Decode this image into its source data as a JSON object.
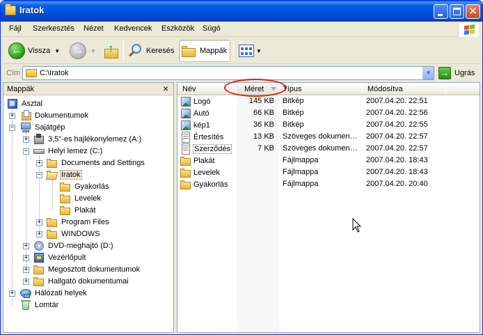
{
  "window": {
    "title": "Iratok"
  },
  "menu": [
    "Fájl",
    "Szerkesztés",
    "Nézet",
    "Kedvencek",
    "Eszközök",
    "Súgó"
  ],
  "toolbar": {
    "back_label": "Vissza",
    "search_label": "Keresés",
    "folders_label": "Mappák"
  },
  "address": {
    "label": "Cím",
    "value": "C:\\Iratok",
    "go_label": "Ugrás"
  },
  "folder_pane": {
    "title": "Mappák",
    "close": "×",
    "tree": [
      {
        "label": "Asztal",
        "icon": "desktop-icon",
        "expander": ""
      },
      {
        "label": "Dokumentumok",
        "icon": "my-documents-icon",
        "expander": "+"
      },
      {
        "label": "Sajátgép",
        "icon": "my-computer-icon",
        "expander": "−"
      },
      {
        "label": "3,5\"-es hajlékonylemez (A:)",
        "icon": "floppy-drive-icon",
        "expander": "+"
      },
      {
        "label": "Helyi lemez (C:)",
        "icon": "hard-drive-icon",
        "expander": "−"
      },
      {
        "label": "Documents and Settings",
        "icon": "folder-icon",
        "expander": "+"
      },
      {
        "label": "Iratok",
        "icon": "open-folder-icon",
        "expander": "−",
        "selected": true
      },
      {
        "label": "Gyakorlás",
        "icon": "folder-icon",
        "expander": ""
      },
      {
        "label": "Levelek",
        "icon": "folder-icon",
        "expander": ""
      },
      {
        "label": "Plakát",
        "icon": "folder-icon",
        "expander": ""
      },
      {
        "label": "Program Files",
        "icon": "folder-icon",
        "expander": "+"
      },
      {
        "label": "WINDOWS",
        "icon": "folder-icon",
        "expander": "+"
      },
      {
        "label": "DVD-meghajtó (D:)",
        "icon": "dvd-drive-icon",
        "expander": "+"
      },
      {
        "label": "Vezérlőpult",
        "icon": "control-panel-icon",
        "expander": "+"
      },
      {
        "label": "Megosztott dokumentumok",
        "icon": "folder-icon",
        "expander": "+"
      },
      {
        "label": "Hallgató dokumentumai",
        "icon": "folder-icon",
        "expander": "+"
      },
      {
        "label": "Hálózati helyek",
        "icon": "network-places-icon",
        "expander": "+"
      },
      {
        "label": "Lomtár",
        "icon": "recycle-bin-icon",
        "expander": ""
      }
    ]
  },
  "file_list": {
    "columns": [
      "Név",
      "Méret",
      "Típus",
      "Módosítva"
    ],
    "rows": [
      {
        "name": "Logó",
        "size": "145 KB",
        "type": "Bitkép",
        "modified": "2007.04.20. 22:51",
        "icon": "bitmap-icon"
      },
      {
        "name": "Autó",
        "size": "66 KB",
        "type": "Bitkép",
        "modified": "2007.04.20. 22:56",
        "icon": "bitmap-icon"
      },
      {
        "name": "kép1",
        "size": "36 KB",
        "type": "Bitkép",
        "modified": "2007.04.20. 22:55",
        "icon": "bitmap-icon"
      },
      {
        "name": "Értesítés",
        "size": "13 KB",
        "type": "Szöveges dokumentum",
        "modified": "2007.04.20. 22:57",
        "icon": "text-document-icon"
      },
      {
        "name": "Szerződés",
        "size": "7 KB",
        "type": "Szöveges dokumentum",
        "modified": "2007.04.20. 22:57",
        "icon": "text-document-icon"
      },
      {
        "name": "Plakát",
        "size": "",
        "type": "Fájlmappa",
        "modified": "2007.04.20. 18:43",
        "icon": "folder-icon"
      },
      {
        "name": "Levelek",
        "size": "",
        "type": "Fájlmappa",
        "modified": "2007.04.20. 18:43",
        "icon": "folder-icon"
      },
      {
        "name": "Gyakorlás",
        "size": "",
        "type": "Fájlmappa",
        "modified": "2007.04.20. 20:40",
        "icon": "folder-icon"
      }
    ]
  },
  "colors": {
    "titlebar": "#0054E3",
    "chrome": "#ECE9D8",
    "annotation": "#D7231E"
  }
}
